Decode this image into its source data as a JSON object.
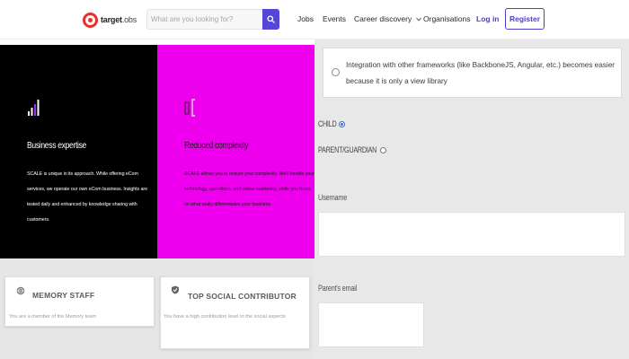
{
  "navbar": {
    "logo": {
      "name_bold": "target",
      "name_light": "obs"
    },
    "search": {
      "placeholder": "What are you looking for?",
      "value": ""
    },
    "links": {
      "jobs": "Jobs",
      "events": "Events",
      "career_discovery": "Career discovery",
      "organisations": "Organisations",
      "login": "Log in"
    },
    "register_label": "Register"
  },
  "features": [
    {
      "title": "Business expertise",
      "description": "SCALE is unique in its approach. While offering eCom services, we operate our own eCom business. Insights are tested daily and enhanced by knowledge sharing with customers.",
      "icon": "bar-chart-icon"
    },
    {
      "title": "Reduced complexity",
      "description": "SCALE allows you to ensure your complexity. We'll handle your technology, operations, and online marketing, while you focus on what really differentiates your business.",
      "icon": "bracket-icon"
    }
  ],
  "badges": [
    {
      "title": "MEMORY STAFF",
      "description": "You are a member of the Memory team",
      "icon": "globe-badge-icon"
    },
    {
      "title": "TOP SOCIAL CONTRIBUTOR",
      "description": "You have a high contribution level to the social aspects",
      "icon": "shield-badge-icon"
    }
  ],
  "form": {
    "option_text": "Integration with other frameworks (like BackboneJS, Angular, etc.) becomes easier because it is only a view library",
    "roles": [
      {
        "label": "CHILD",
        "checked": true
      },
      {
        "label": "PARENT/GUARDIAN",
        "checked": false
      }
    ],
    "username_label": "Username",
    "username_value": "",
    "parent_email_label": "Parent's email",
    "parent_email_value": ""
  },
  "colors": {
    "brand": "#e8302a",
    "accent": "#4b3fd0",
    "magenta_panel": "#ee00ee",
    "black_panel": "#000000"
  }
}
